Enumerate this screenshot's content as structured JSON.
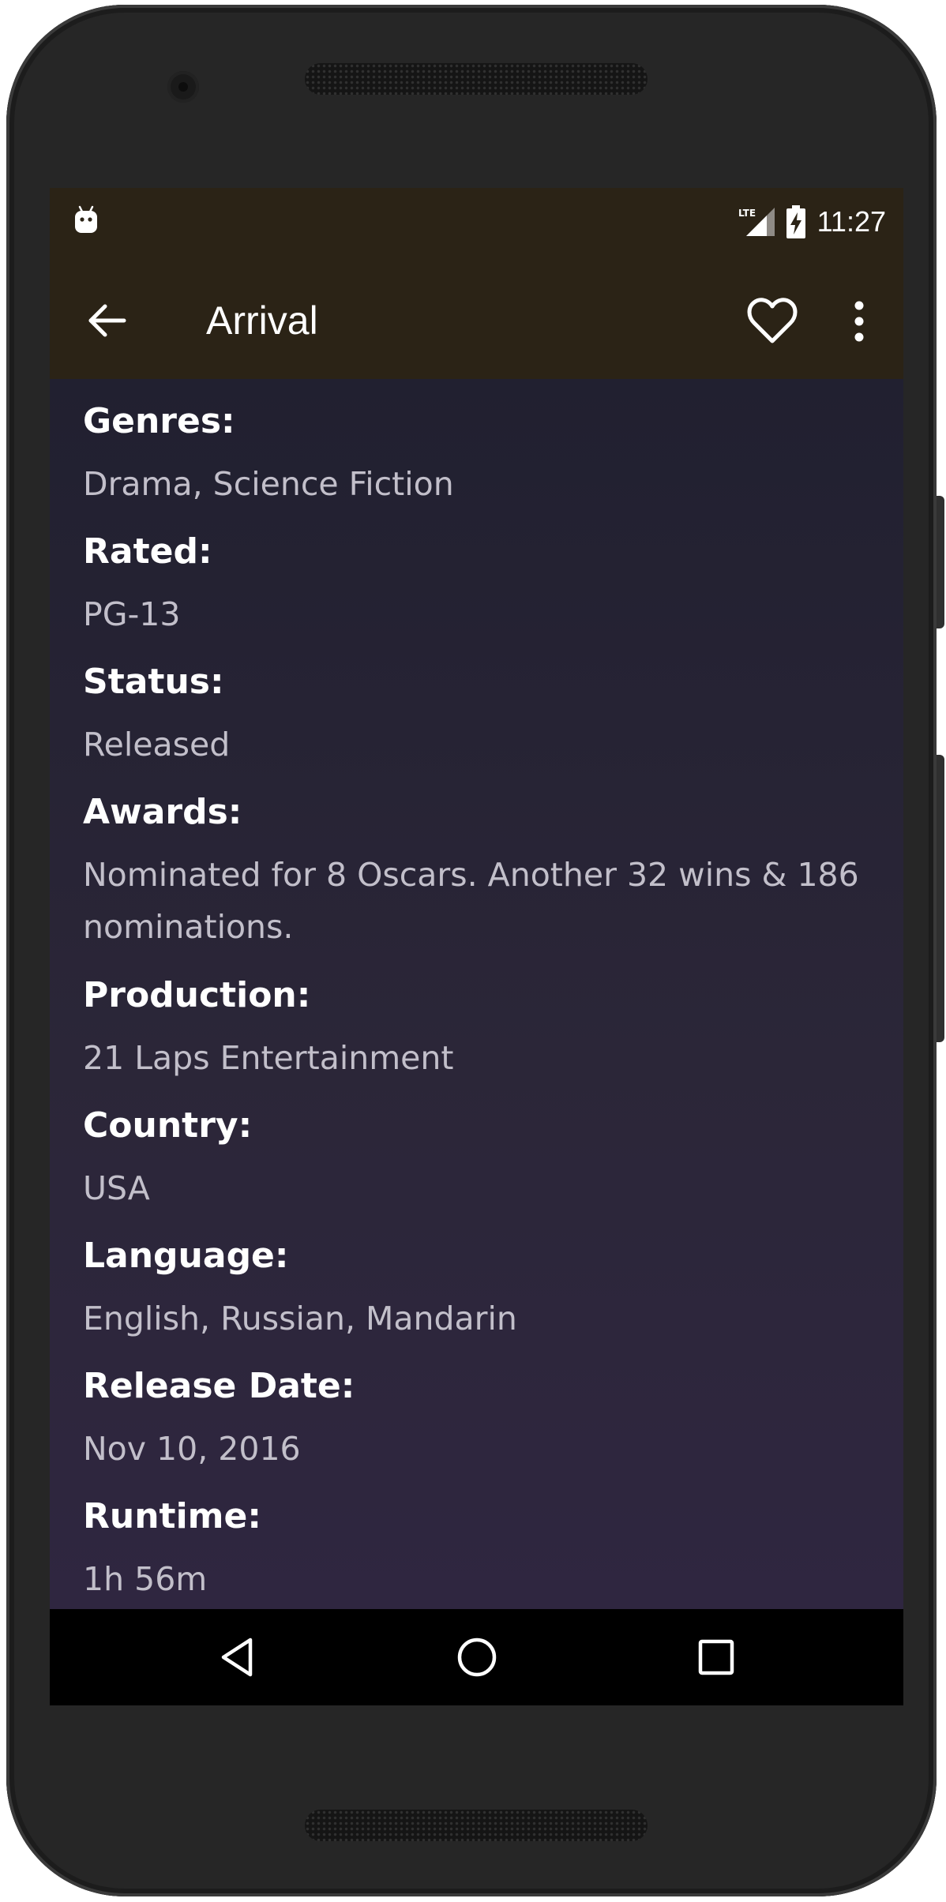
{
  "status_bar": {
    "time": "11:27",
    "network": "LTE",
    "icons": [
      "android-debug-icon",
      "lte-signal-icon",
      "battery-charging-icon"
    ]
  },
  "app_bar": {
    "title": "Arrival",
    "icons": [
      "back-arrow-icon",
      "heart-outline-icon",
      "more-vert-icon"
    ]
  },
  "details": [
    {
      "label": "Genres:",
      "value": "Drama, Science Fiction"
    },
    {
      "label": "Rated:",
      "value": "PG-13"
    },
    {
      "label": "Status:",
      "value": "Released"
    },
    {
      "label": "Awards:",
      "value": "Nominated for 8 Oscars. Another 32 wins & 186 nominations."
    },
    {
      "label": "Production:",
      "value": "21 Laps Entertainment"
    },
    {
      "label": "Country:",
      "value": "USA"
    },
    {
      "label": "Language:",
      "value": "English, Russian, Mandarin"
    },
    {
      "label": "Release Date:",
      "value": "Nov 10, 2016"
    },
    {
      "label": "Runtime:",
      "value": "1h 56m"
    }
  ],
  "nav_bar": {
    "icons": [
      "nav-back-icon",
      "nav-home-icon",
      "nav-recents-icon"
    ]
  },
  "colors": {
    "app_bar": "#2b2316",
    "content_background": "#2a2537",
    "label": "#ffffff",
    "value": "#c2bfca",
    "nav_bar": "#000000"
  }
}
